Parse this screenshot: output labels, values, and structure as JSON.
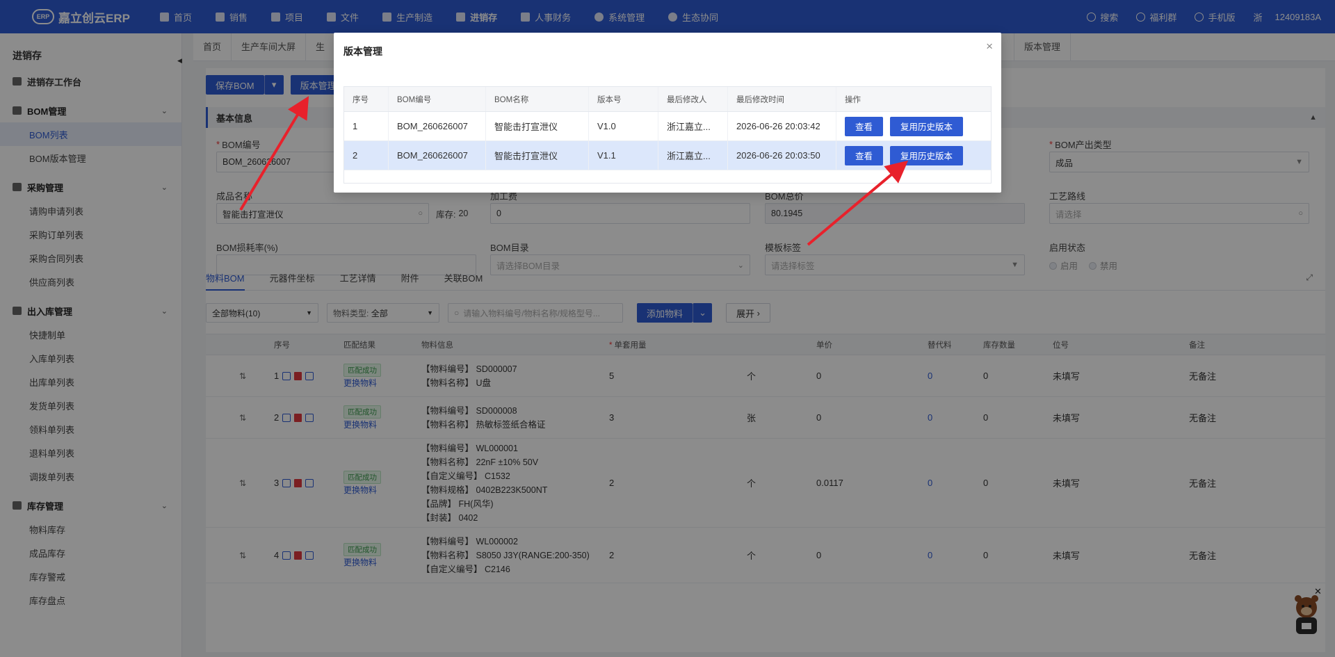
{
  "header": {
    "logo_badge": "ERP",
    "logo_text": "嘉立创云ERP",
    "nav": [
      "首页",
      "销售",
      "项目",
      "文件",
      "生产制造",
      "进销存",
      "人事财务",
      "系统管理",
      "生态协同"
    ],
    "right": {
      "search": "搜索",
      "group": "福利群",
      "mobile": "手机版",
      "region": "浙",
      "account": "12409183A"
    }
  },
  "sidebar": {
    "title": "进销存",
    "workbench": "进销存工作台",
    "groups": [
      {
        "label": "BOM管理",
        "items": [
          "BOM列表",
          "BOM版本管理"
        ]
      },
      {
        "label": "采购管理",
        "items": [
          "请购申请列表",
          "采购订单列表",
          "采购合同列表",
          "供应商列表"
        ]
      },
      {
        "label": "出入库管理",
        "items": [
          "快捷制单",
          "入库单列表",
          "出库单列表",
          "发货单列表",
          "领料单列表",
          "退料单列表",
          "调拨单列表"
        ]
      },
      {
        "label": "库存管理",
        "items": [
          "物料库存",
          "成品库存",
          "库存警戒",
          "库存盘点"
        ]
      }
    ],
    "active_item": "BOM列表"
  },
  "page_tabs": [
    "首页",
    "生产车间大屏",
    "生",
    "版本管理"
  ],
  "toolbar": {
    "save_bom": "保存BOM",
    "version_mgmt": "版本管理"
  },
  "basic_info": {
    "section_title": "基本信息",
    "bom_no": {
      "label": "BOM编号",
      "value": "BOM_260626007"
    },
    "product_name": {
      "label": "成品名称",
      "value": "智能击打宣泄仪",
      "stock_label": "库存:",
      "stock_value": "20"
    },
    "processing_fee": {
      "label": "加工费",
      "value": "0"
    },
    "bom_total": {
      "label": "BOM总价",
      "value": "80.1945"
    },
    "route": {
      "label": "工艺路线",
      "placeholder": "请选择"
    },
    "loss_rate": {
      "label": "BOM损耗率(%)",
      "value": ""
    },
    "catalog": {
      "label": "BOM目录",
      "placeholder": "请选择BOM目录"
    },
    "template_tag": {
      "label": "模板标签",
      "placeholder": "请选择标签"
    },
    "output_type": {
      "label": "BOM产出类型",
      "value": "成品"
    },
    "status": {
      "label": "启用状态",
      "on": "启用",
      "off": "禁用"
    }
  },
  "subtabs": [
    "物料BOM",
    "元器件坐标",
    "工艺详情",
    "附件",
    "关联BOM"
  ],
  "filters": {
    "all_materials": "全部物料(10)",
    "type_label": "物料类型:",
    "type_value": "全部",
    "search_placeholder": "请输入物料编号/物料名称/规格型号...",
    "add_material": "添加物料",
    "expand": "展开"
  },
  "grid": {
    "headers": [
      "序号",
      "匹配结果",
      "物料信息",
      "单套用量",
      "单价",
      "替代料",
      "库存数量",
      "位号",
      "备注"
    ],
    "rows": [
      {
        "no": "1",
        "match": "匹配成功",
        "change": "更换物料",
        "info": [
          [
            "【物料编号】",
            "SD000007"
          ],
          [
            "【物料名称】",
            "U盘"
          ]
        ],
        "qty": "5",
        "unit": "个",
        "price": "0",
        "alt": "0",
        "stock": "0",
        "pos": "未填写",
        "remark": "无备注"
      },
      {
        "no": "2",
        "match": "匹配成功",
        "change": "更换物料",
        "info": [
          [
            "【物料编号】",
            "SD000008"
          ],
          [
            "【物料名称】",
            "热敏标签纸合格证"
          ]
        ],
        "qty": "3",
        "unit": "张",
        "price": "0",
        "alt": "0",
        "stock": "0",
        "pos": "未填写",
        "remark": "无备注"
      },
      {
        "no": "3",
        "match": "匹配成功",
        "change": "更换物料",
        "info": [
          [
            "【物料编号】",
            "WL000001"
          ],
          [
            "【物料名称】",
            "22nF ±10% 50V"
          ],
          [
            "【自定义编号】",
            "C1532"
          ],
          [
            "【物料规格】",
            "0402B223K500NT"
          ],
          [
            "【品牌】",
            "FH(风华)"
          ],
          [
            "【封装】",
            "0402"
          ]
        ],
        "qty": "2",
        "unit": "个",
        "price": "0.0117",
        "alt": "0",
        "stock": "0",
        "pos": "未填写",
        "remark": "无备注"
      },
      {
        "no": "4",
        "match": "匹配成功",
        "change": "更换物料",
        "info": [
          [
            "【物料编号】",
            "WL000002"
          ],
          [
            "【物料名称】",
            "S8050 J3Y(RANGE:200-350)"
          ],
          [
            "【自定义编号】",
            "C2146"
          ]
        ],
        "qty": "2",
        "unit": "个",
        "price": "0",
        "alt": "0",
        "stock": "0",
        "pos": "未填写",
        "remark": "无备注"
      }
    ]
  },
  "modal": {
    "title": "版本管理",
    "headers": [
      "序号",
      "BOM编号",
      "BOM名称",
      "版本号",
      "最后修改人",
      "最后修改时间",
      "操作"
    ],
    "rows": [
      {
        "no": "1",
        "bom_no": "BOM_260626007",
        "name": "智能击打宣泄仪",
        "version": "V1.0",
        "modifier": "浙江嘉立...",
        "time": "2026-06-26 20:03:42"
      },
      {
        "no": "2",
        "bom_no": "BOM_260626007",
        "name": "智能击打宣泄仪",
        "version": "V1.1",
        "modifier": "浙江嘉立...",
        "time": "2026-06-26 20:03:50"
      }
    ],
    "view_btn": "查看",
    "reuse_btn": "复用历史版本"
  },
  "colors": {
    "primary": "#2f5bd3",
    "arrow": "#e8212b",
    "success": "#3c9b4f",
    "danger": "#e0393e"
  }
}
